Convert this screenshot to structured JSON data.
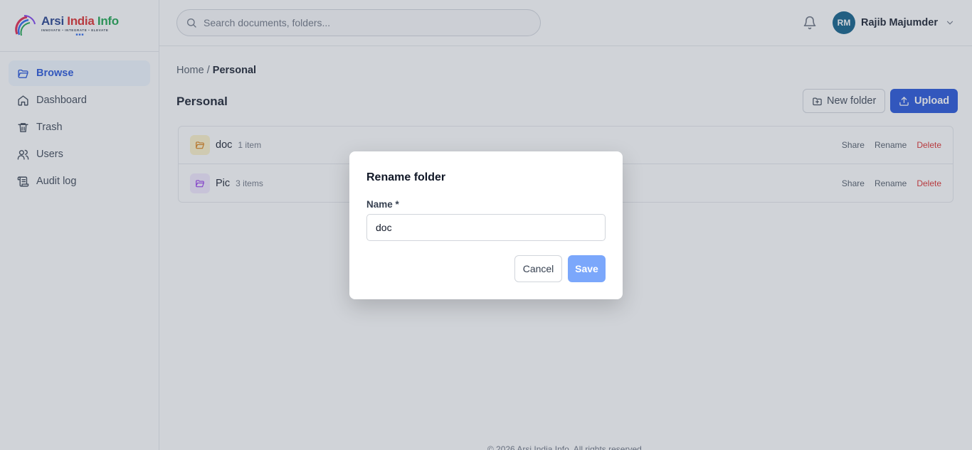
{
  "brand": {
    "name_part1": "Arsi",
    "name_part2": " India",
    "name_part3": " Info",
    "tagline": "INNOVATE • INTEGRATE • ELEVATE",
    "dots": "■■■"
  },
  "sidebar": {
    "items": [
      {
        "label": "Browse",
        "icon": "folder-open-icon",
        "active": true
      },
      {
        "label": "Dashboard",
        "icon": "home-icon",
        "active": false
      },
      {
        "label": "Trash",
        "icon": "trash-icon",
        "active": false
      },
      {
        "label": "Users",
        "icon": "users-icon",
        "active": false
      },
      {
        "label": "Audit log",
        "icon": "scroll-icon",
        "active": false
      }
    ]
  },
  "header": {
    "search_placeholder": "Search documents, folders...",
    "user_initials": "RM",
    "user_name": "Rajib Majumder"
  },
  "main": {
    "breadcrumb": {
      "home": "Home",
      "separator": " / ",
      "current": "Personal"
    },
    "title": "Personal",
    "new_folder_label": "New folder",
    "upload_label": "Upload",
    "folders": [
      {
        "name": "doc",
        "count": "1 item",
        "color": "#f59e0b"
      },
      {
        "name": "Pic",
        "count": "3 items",
        "color": "#a855f7"
      }
    ],
    "row_actions": {
      "share": "Share",
      "rename": "Rename",
      "delete": "Delete"
    }
  },
  "footer": {
    "text": "© 2026 Arsi India Info. All rights reserved."
  },
  "modal": {
    "title": "Rename folder",
    "name_label": "Name *",
    "name_value": "doc",
    "cancel_label": "Cancel",
    "save_label": "Save"
  },
  "colors": {
    "accent": "#1d4ed8",
    "avatar": "#075985",
    "danger": "#dc2626",
    "save_disabled": "#7ba7fb"
  }
}
